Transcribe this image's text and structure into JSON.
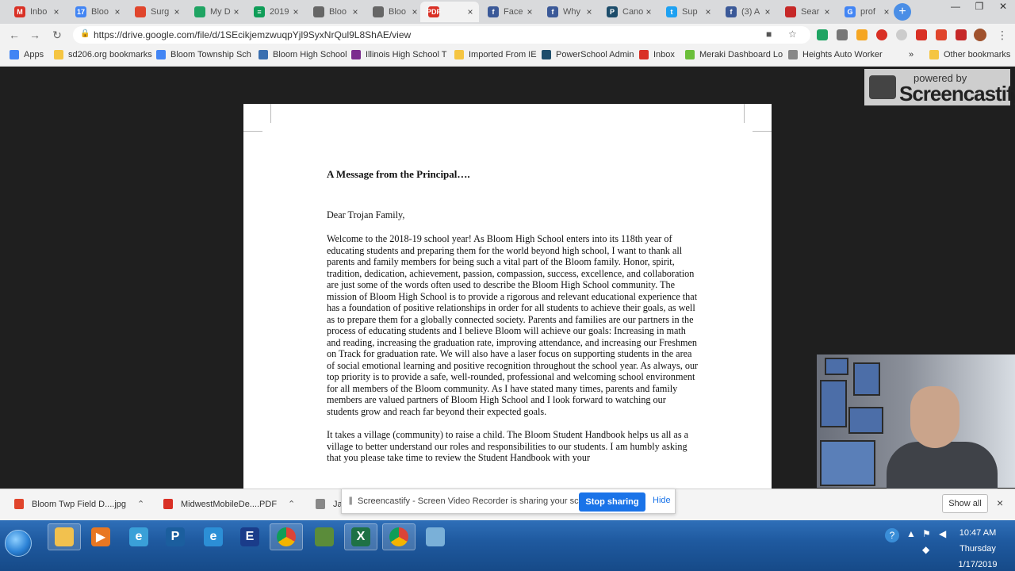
{
  "tabs": [
    {
      "label": "Inbo",
      "icon": "gmail-icon",
      "color": "#d93025",
      "glyph": "M"
    },
    {
      "label": "Bloo",
      "icon": "calendar-icon",
      "color": "#4285f4",
      "glyph": "17"
    },
    {
      "label": "Surg",
      "icon": "chrome-icon",
      "color": "#e0452c",
      "glyph": ""
    },
    {
      "label": "My D",
      "icon": "drive-icon",
      "color": "#1fa463",
      "glyph": ""
    },
    {
      "label": "2019",
      "icon": "sheets-icon",
      "color": "#0f9d58",
      "glyph": "≡"
    },
    {
      "label": "Bloo",
      "icon": "document-icon",
      "color": "#666666",
      "glyph": ""
    },
    {
      "label": "Bloo",
      "icon": "document-icon",
      "color": "#666666",
      "glyph": ""
    },
    {
      "label": "",
      "icon": "pdf-icon",
      "color": "#d93025",
      "glyph": "PDF",
      "active": true
    },
    {
      "label": "Face",
      "icon": "facebook-icon",
      "color": "#3b5998",
      "glyph": "f"
    },
    {
      "label": "Why",
      "icon": "facebook-icon",
      "color": "#3b5998",
      "glyph": "f"
    },
    {
      "label": "Cano",
      "icon": "powerschool-icon",
      "color": "#1d4d6b",
      "glyph": "P"
    },
    {
      "label": "Sup",
      "icon": "twitter-icon",
      "color": "#1da1f2",
      "glyph": "t"
    },
    {
      "label": "(3) A",
      "icon": "facebook-icon",
      "color": "#3b5998",
      "glyph": "f"
    },
    {
      "label": "Sear",
      "icon": "search-icon",
      "color": "#c62828",
      "glyph": ""
    },
    {
      "label": "prof",
      "icon": "google-icon",
      "color": "#4285f4",
      "glyph": "G"
    }
  ],
  "address": {
    "url": "https://drive.google.com/file/d/1SEcikjemzwuqpYjl9SyxNrQul9L8ShAE/view"
  },
  "bookmarks": [
    {
      "label": "Apps",
      "icon": "apps-icon",
      "color": "#4285f4"
    },
    {
      "label": "sd206.org bookmarks",
      "icon": "folder-icon",
      "color": "#f5c542"
    },
    {
      "label": "Bloom Township Sch",
      "icon": "calendar-icon",
      "color": "#4285f4"
    },
    {
      "label": "Bloom High School",
      "icon": "school-icon",
      "color": "#3a6fb0"
    },
    {
      "label": "Illinois High School T",
      "icon": "ihsa-icon",
      "color": "#7b2d8e"
    },
    {
      "label": "Imported From IE",
      "icon": "folder-icon",
      "color": "#f5c542"
    },
    {
      "label": "PowerSchool Admin",
      "icon": "powerschool-icon",
      "color": "#1d4d6b"
    },
    {
      "label": "Inbox",
      "icon": "gmail-icon",
      "color": "#d93025"
    },
    {
      "label": "Meraki Dashboard Lo",
      "icon": "meraki-icon",
      "color": "#6bbf3a"
    },
    {
      "label": "Heights Auto Worker",
      "icon": "page-icon",
      "color": "#888888"
    },
    {
      "label": "»",
      "icon": "overflow-icon",
      "color": "#f2f2f2"
    },
    {
      "label": "Other bookmarks",
      "icon": "folder-icon",
      "color": "#f5c542"
    }
  ],
  "document": {
    "heading": "A Message from the Principal….",
    "greeting": "Dear Trojan Family,",
    "paragraph1": "Welcome to the 2018-19 school year!  As Bloom High School enters into its 118th year of educating students and preparing them for the world beyond high school, I want to thank all parents and family members for being such a vital part of the Bloom family.  Honor, spirit, tradition, dedication, achievement, passion, compassion, success, excellence, and collaboration are just some of the words often used to describe the Bloom High School community.  The mission of Bloom High School is to provide a rigorous and relevant educational experience that has a foundation of positive relationships in order for all students to achieve their goals, as well as to prepare them for a globally connected society.  Parents and families are our partners in the process of educating students and I believe Bloom will achieve our goals:  Increasing in math and reading, increasing the graduation rate, improving attendance, and increasing our Freshmen on Track for graduation rate.  We will also have a laser focus on supporting students in the area of social emotional learning and positive recognition throughout the school year.  As always, our top priority is to provide a safe, well-rounded, professional and welcoming school environment for all members of the Bloom community.  As I have stated many times, parents and family members are valued partners of Bloom High School and I look forward to watching our students grow and reach far beyond their expected goals.",
    "paragraph2": "It takes a village (community) to raise a child.  The Bloom Student Handbook helps us all as a village to better understand our roles and responsibilities to our students.  I am humbly asking that you please take time to review the Student Handbook with your"
  },
  "watermark": {
    "small": "powered by",
    "big": "Screencastify"
  },
  "recording_controls": [
    "pause-icon",
    "cursor-icon",
    "pen-icon",
    "highlighter-icon",
    "camera-icon",
    "timer-icon",
    "close-icon"
  ],
  "downloads": [
    {
      "name": "Bloom Twp Field D....jpg",
      "color": "#e0452c"
    },
    {
      "name": "MidwestMobileDe....PDF",
      "color": "#d93025"
    },
    {
      "name": "Ja",
      "color": "#888888"
    }
  ],
  "notification": {
    "text": "Screencastify - Screen Video Recorder is sharing your screen.",
    "stop_label": "Stop sharing",
    "hide_label": "Hide"
  },
  "shelf": {
    "show_all": "Show all",
    "close": "×"
  },
  "taskbar": {
    "apps": [
      {
        "name": "explorer-icon",
        "color": "#f2c14e",
        "glyph": ""
      },
      {
        "name": "media-player-icon",
        "color": "#e87722",
        "glyph": "▶"
      },
      {
        "name": "internet-icon",
        "color": "#3aa0d8",
        "glyph": "e"
      },
      {
        "name": "publisher-icon",
        "color": "#1b5e9e",
        "glyph": "P"
      },
      {
        "name": "ie-icon",
        "color": "#2c8fd6",
        "glyph": "e"
      },
      {
        "name": "app-e-icon",
        "color": "#1a3c8a",
        "glyph": "E"
      },
      {
        "name": "chrome-icon",
        "color": "#e0452c",
        "glyph": ""
      },
      {
        "name": "person-app-icon",
        "color": "#5b8c3a",
        "glyph": ""
      },
      {
        "name": "excel-icon",
        "color": "#1e7145",
        "glyph": "X"
      },
      {
        "name": "chrome-icon",
        "color": "#e0452c",
        "glyph": ""
      },
      {
        "name": "network-app-icon",
        "color": "#7ab0d8",
        "glyph": ""
      }
    ],
    "time": "10:47 AM",
    "day": "Thursday",
    "date": "1/17/2019"
  }
}
